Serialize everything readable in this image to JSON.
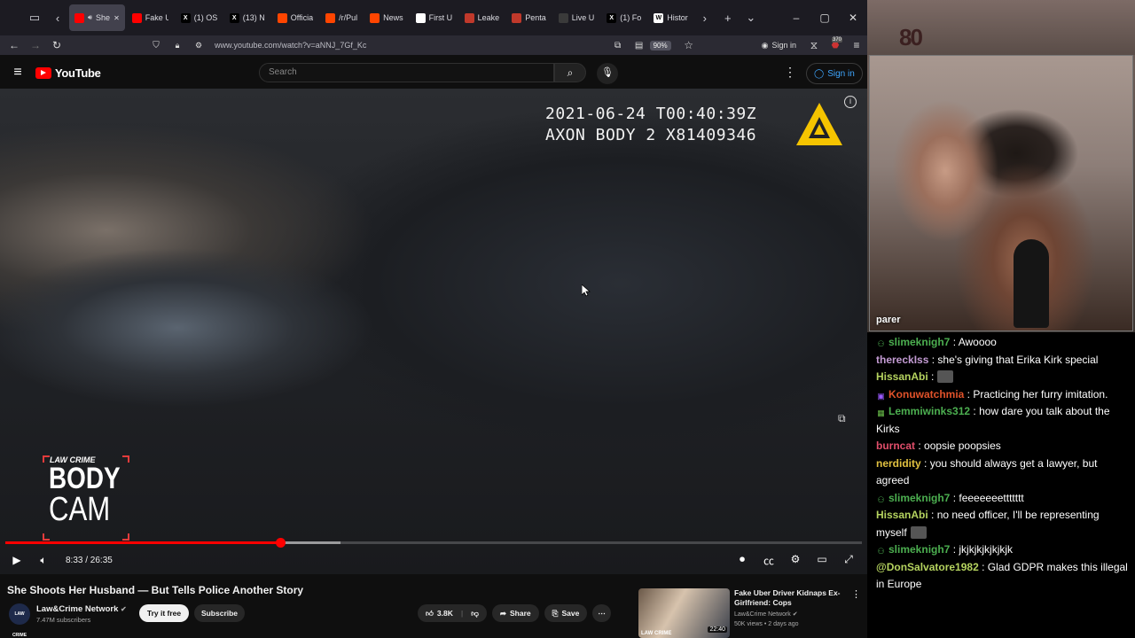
{
  "browser": {
    "tabs": [
      {
        "label": "She",
        "color": "#ff0000",
        "active": true
      },
      {
        "label": "Fake U",
        "color": "#ff0000"
      },
      {
        "label": "(1) OS",
        "color": "#000000",
        "glyph": "X"
      },
      {
        "label": "(13) N",
        "color": "#000000",
        "glyph": "X"
      },
      {
        "label": "Officia",
        "color": "#ff4500"
      },
      {
        "label": "/r/Pul",
        "color": "#ff4500"
      },
      {
        "label": "News",
        "color": "#ff4500"
      },
      {
        "label": "First U",
        "color": "#ffffff"
      },
      {
        "label": "Leake",
        "color": "#c0392b"
      },
      {
        "label": "Penta",
        "color": "#c0392b"
      },
      {
        "label": "Live U",
        "color": "#3a3a3a"
      },
      {
        "label": "(1) Fo",
        "color": "#000000",
        "glyph": "X"
      },
      {
        "label": "Histor",
        "color": "#ffffff",
        "glyph": "W"
      }
    ],
    "url": "www.youtube.com/watch?v=aNNJ_7Gf_Kc",
    "zoom": "90%",
    "signin": "Sign in",
    "badge_count": "370"
  },
  "youtube": {
    "logo": "YouTube",
    "search_placeholder": "Search",
    "signin": "Sign in"
  },
  "player": {
    "timestamp_line1": "2021-06-24 T00:40:39Z",
    "timestamp_line2": "AXON BODY 2 X81409346",
    "badge_top": "LAW CRIME",
    "badge_line1": "BODY",
    "badge_line2": "CAM",
    "time": "8:33 / 26:35",
    "progress": 0.321,
    "buffered": 0.391
  },
  "video": {
    "title": "She Shoots Her Husband — But Tells Police Another Story",
    "channel": "Law&Crime Network",
    "channel_avatar": "LAW CRIME",
    "subscribers": "7.47M subscribers",
    "try_label": "Try it free",
    "subscribe_label": "Subscribe",
    "likes": "3.8K",
    "share_label": "Share",
    "save_label": "Save"
  },
  "related": {
    "title": "Fake Uber Driver Kidnaps Ex-Girlfriend: Cops",
    "channel": "Law&Crime Network",
    "meta": "50K views • 2 days ago",
    "duration": "22:40",
    "thumb_text": "LAW CRIME"
  },
  "stream": {
    "cam_label": "parer",
    "logo": "80"
  },
  "chat": [
    {
      "user": "slimeknigh7",
      "color": "#4caf50",
      "text": "Awoooo",
      "icon": "badge"
    },
    {
      "user": "thereckIss",
      "color": "#c39bd3",
      "text": "she's giving that Erika Kirk special"
    },
    {
      "user": "HissanAbi",
      "color": "#b5d35f",
      "text": "",
      "emote": true
    },
    {
      "user": "Konuwatchmia",
      "color": "#e0522a",
      "text": "Practicing her furry imitation.",
      "icon": "sub"
    },
    {
      "user": "Lemmiwinks312",
      "color": "#4caf50",
      "text": "how dare you talk about the Kirks",
      "icon": "gift"
    },
    {
      "user": "burncat",
      "color": "#e04e6a",
      "text": "oopsie poopsies"
    },
    {
      "user": "nerdidity",
      "color": "#e0c040",
      "text": "you should always get a lawyer, but agreed"
    },
    {
      "user": "slimeknigh7",
      "color": "#4caf50",
      "text": "feeeeeeettttttt",
      "icon": "badge"
    },
    {
      "user": "HissanAbi",
      "color": "#b5d35f",
      "text": "no need officer, I'll be representing myself",
      "emote_after": true
    },
    {
      "user": "slimeknigh7",
      "color": "#4caf50",
      "text": "jkjkjkjkjkjkjk",
      "icon": "badge"
    },
    {
      "user": "@DonSalvatore1982",
      "color": "#b5d35f",
      "text": "Glad GDPR makes this illegal in Europe"
    }
  ]
}
